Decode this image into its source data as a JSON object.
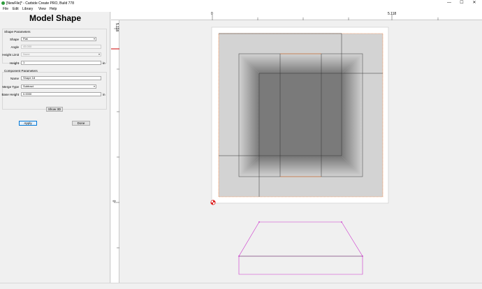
{
  "window": {
    "title": "[NewFile]* - Carbide Create PRO, Build 778"
  },
  "window_controls": {
    "minimize": "—",
    "maximize": "☐",
    "close": "✕"
  },
  "menu": {
    "items": [
      "File",
      "Edit",
      "Library",
      "View",
      "Help"
    ]
  },
  "panel": {
    "title": "Model Shape",
    "shape_params_label": "Shape Parameters",
    "shape": {
      "label": "Shape",
      "value": "Flat"
    },
    "angle": {
      "label": "Angle",
      "value": "45.000"
    },
    "height_limit": {
      "label": "Height Limit",
      "value": "None"
    },
    "height": {
      "label": "Height",
      "value": "1",
      "unit": "in"
    },
    "component_params_label": "Component Parameters",
    "name": {
      "label": "Name",
      "value": "Shape 18"
    },
    "merge_type": {
      "label": "Merge Type",
      "value": "Subtract"
    },
    "base_height": {
      "label": "Base Height",
      "value": "0.0000",
      "unit": "in"
    },
    "show_3d_label": "Show 3D",
    "apply_label": "Apply",
    "done_label": "Done"
  },
  "rulers": {
    "top_start": "0",
    "top_end": "5.118",
    "left_top": "5.118",
    "left_zero": "0"
  },
  "colors": {
    "outline": "#ff7a2a",
    "profile": "#cc33cc",
    "accent": "#0078d7"
  },
  "icons": {
    "app": "carbide-logo-icon",
    "origin": "origin-marker-icon"
  }
}
